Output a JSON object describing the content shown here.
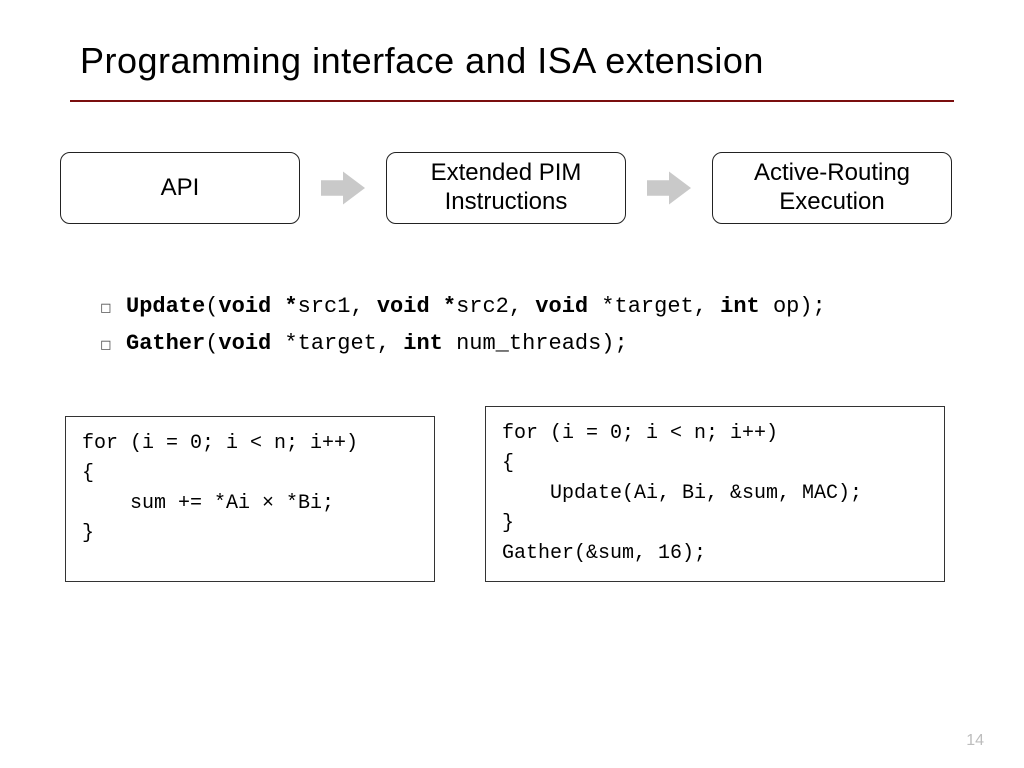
{
  "title": "Programming interface and ISA extension",
  "flow": {
    "box1": "API",
    "box2": "Extended PIM\nInstructions",
    "box3": "Active-Routing\nExecution"
  },
  "api": {
    "update": "Update(void *src1, void *src2, void *target, int op);",
    "gather": "Gather(void *target, int num_threads);"
  },
  "code": {
    "left": "for (i = 0; i < n; i++)\n{\n    sum += *Ai × *Bi;\n}",
    "right": "for (i = 0; i < n; i++)\n{\n    Update(Ai, Bi, &sum, MAC);\n}\nGather(&sum, 16);"
  },
  "pagenum": "14"
}
